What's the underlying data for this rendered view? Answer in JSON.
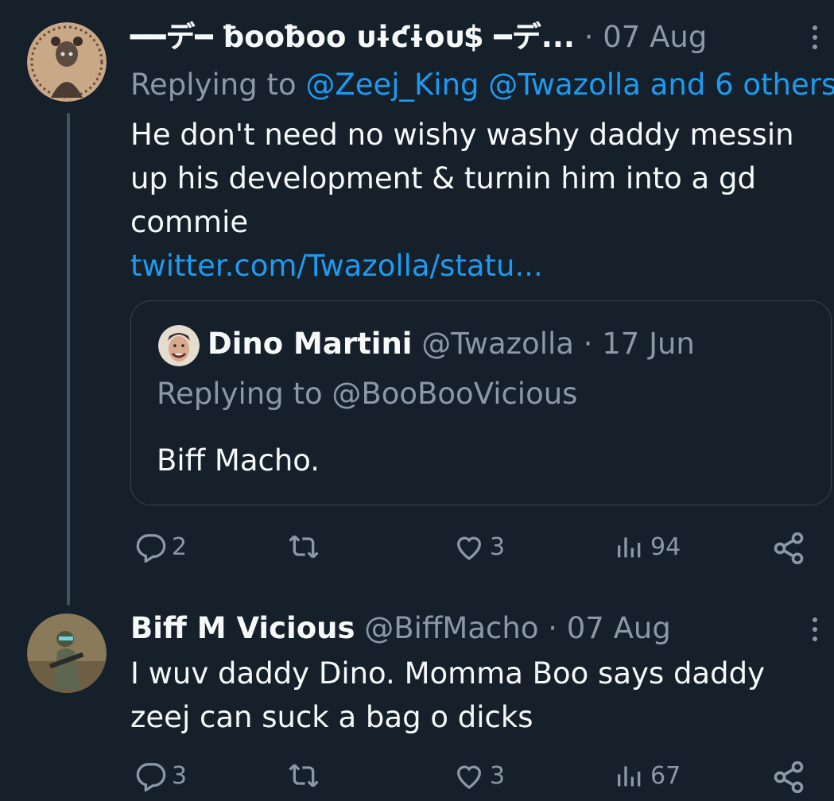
{
  "tweet1": {
    "display_name": "━━デ━ ƀooƀoo ᴜɨƈɨoᴜ$ ━デ...",
    "date": "· 07 Aug",
    "replying_label": "Replying to",
    "replying_handles": "@Zeej_King @Twazolla and 6 others",
    "text_line1": "He don't need no wishy washy daddy messin",
    "text_line2": "up his development & turnin him into a gd",
    "text_line3": "commie",
    "link": "twitter.com/Twazolla/statu...",
    "quote": {
      "display_name": "Dino Martini",
      "handle": "@Twazolla",
      "date": "· 17 Jun",
      "replying_label": "Replying to",
      "replying_handle": "@BooBooVicious",
      "text": "Biff Macho."
    },
    "actions": {
      "replies": "2",
      "retweets": "",
      "likes": "3",
      "views": "94"
    }
  },
  "tweet2": {
    "display_name": "Biff M Vicious",
    "handle": "@BiffMacho",
    "date": "· 07 Aug",
    "text_line1": "I wuv daddy Dino. Momma Boo says daddy",
    "text_line2": "zeej can suck a bag o dicks",
    "actions": {
      "replies": "3",
      "retweets": "",
      "likes": "3",
      "views": "67"
    }
  },
  "colors": {
    "background": "#15202b",
    "text": "#f7f9f9",
    "secondary": "#8b98a5",
    "accent": "#1d9bf0",
    "border": "#38444d"
  },
  "icons": [
    "reply-icon",
    "retweet-icon",
    "like-icon",
    "views-icon",
    "share-icon",
    "more-icon"
  ]
}
